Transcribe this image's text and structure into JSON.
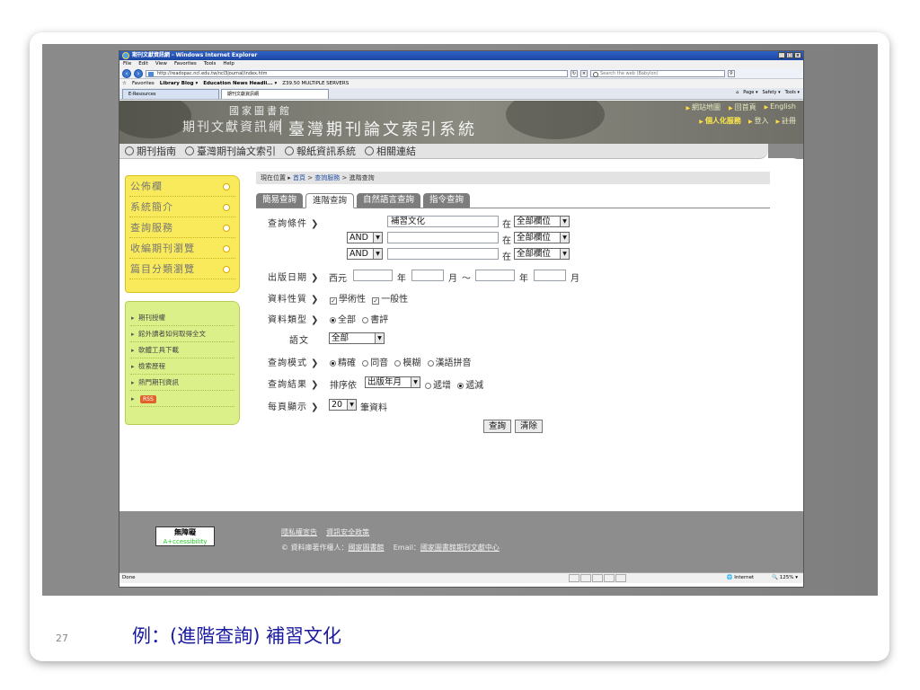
{
  "browser": {
    "window_title": "期刊文獻資訊網 - Windows Internet Explorer",
    "menu": [
      "File",
      "Edit",
      "View",
      "Favorites",
      "Tools",
      "Help"
    ],
    "address": "http://readopac.ncl.edu.tw/ncl3journal/index.htm",
    "search_placeholder": "Search the web (Babylon)",
    "favorites_label": "Favorites",
    "favorites": [
      "Library Blog ▾",
      "Education News Headli... ▾",
      "Z39.50 MULTIPLE SERVERS"
    ],
    "tabs": [
      "E-Resources",
      "期刊文獻資訊網"
    ],
    "tab_tools": [
      "Page ▾",
      "Safety ▾",
      "Tools ▾"
    ],
    "status": "Done",
    "zone": "Internet",
    "zoom": "125%"
  },
  "header": {
    "library_name": "國家圖書館",
    "system_name": "期刊文獻資訊網",
    "site_title": "臺灣期刊論文索引系統",
    "top_links": [
      "網站地圖",
      "回首頁",
      "English"
    ],
    "user_links": [
      "個人化服務",
      "登入",
      "註冊"
    ]
  },
  "nav": [
    "期刊指南",
    "臺灣期刊論文索引",
    "報紙資訊系統",
    "相關連結"
  ],
  "sidebar": {
    "main": [
      "公佈欄",
      "系統簡介",
      "查詢服務",
      "收編期刊瀏覽",
      "篇目分類瀏覽"
    ],
    "sub": [
      "期刊授權",
      "館外讀者如何取得全文",
      "軟體工具下載",
      "檢索歷程",
      "熱門期刊資訊"
    ],
    "rss": "RSS"
  },
  "breadcrumb": {
    "label": "現在位置",
    "home": "首頁",
    "service": "查詢服務",
    "current": "進階查詢"
  },
  "query_tabs": [
    "簡易查詢",
    "進階查詢",
    "自然語言查詢",
    "指令查詢"
  ],
  "form": {
    "cond_label": "查詢條件",
    "term1": "補習文化",
    "in_label": "在",
    "field_option": "全部欄位",
    "bool_op": "AND",
    "date_label": "出版日期",
    "era": "西元",
    "year": "年",
    "month": "月",
    "tilde": "～",
    "nature_label": "資料性質",
    "nature_opts": [
      "學術性",
      "一般性"
    ],
    "type_label": "資料類型",
    "type_opts": [
      "全部",
      "書評"
    ],
    "lang_label": "語文",
    "lang_value": "全部",
    "mode_label": "查詢模式",
    "mode_opts": [
      "精確",
      "同音",
      "模糊",
      "漢語拼音"
    ],
    "result_label": "查詢結果",
    "sort_prefix": "排序依",
    "sort_value": "出版年月",
    "order_opts": [
      "遞增",
      "遞減"
    ],
    "per_page_label": "每頁顯示",
    "per_page_value": "20",
    "per_page_unit": "筆資料",
    "search_btn": "查詢",
    "clear_btn": "清除"
  },
  "footer": {
    "privacy": "隱私權宣告",
    "security": "資訊安全政策",
    "copyright": "© 資料庫著作權人：",
    "owner": "國家圖書館",
    "email_label": "Email：",
    "email": "國家圖書館期刊文獻中心",
    "accessibility": "無障礙",
    "accessibility_sub": "A+ccessibility"
  },
  "slide": {
    "page_number": "27",
    "caption": "例：(進階查詢) 補習文化"
  }
}
